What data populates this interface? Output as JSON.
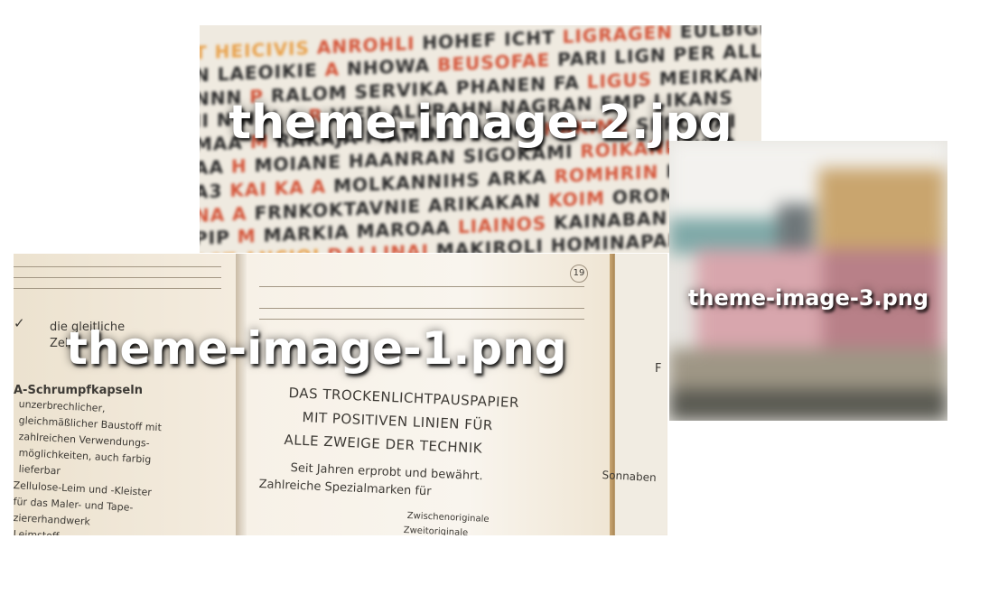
{
  "thumbnails": [
    {
      "id": "card1",
      "label": "theme-image-1.png"
    },
    {
      "id": "card2",
      "label": "theme-image-2.jpg"
    },
    {
      "id": "card3",
      "label": "theme-image-3.png"
    }
  ],
  "booklet_text": {
    "left_heading": "die gleitliche",
    "left_sub": "Zel",
    "left_title": "A-Schrumpfkapseln",
    "left_lines": [
      "unzerbrechlicher,",
      "gleichmäßlicher Baustoff mit",
      "zahlreichen Verwendungs-",
      "möglichkeiten, auch farbig",
      "lieferbar",
      "Zellulose-Leim und -Kleister",
      "für das Maler- und Tape-",
      "ziererhandwerk",
      "Leimstoff"
    ],
    "right_lines": [
      "DAS TROCKENLICHTPAUSPAPIER",
      "MIT POSITIVEN LINIEN FÜR",
      "ALLE ZWEIGE DER TECHNIK"
    ],
    "right_sub": [
      "Seit Jahren erprobt und bewährt.",
      "Zahlreiche Spezialmarken für"
    ],
    "right_small": [
      "Zwischenoriginale",
      "Zweitoriginale"
    ],
    "page_number": "19",
    "back_word": "Sonnaben",
    "back_letter": "F"
  },
  "colors": {
    "background": "#ffffff",
    "caption_text": "#ffffff",
    "accent_red": "#d4553a",
    "accent_orange": "#e8a14b"
  }
}
